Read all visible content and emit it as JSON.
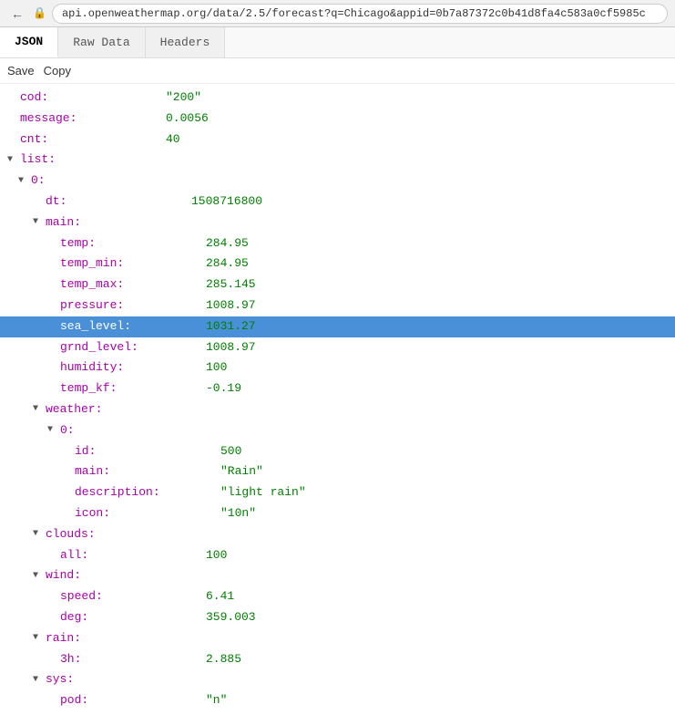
{
  "browser": {
    "url": "api.openweathermap.org/data/2.5/forecast?q=Chicago&appid=0b7a87372c0b41d8fa4c583a0cf5985c",
    "back_label": "←",
    "reload_label": "↻"
  },
  "tabs": [
    {
      "id": "json",
      "label": "JSON",
      "active": true
    },
    {
      "id": "raw",
      "label": "Raw Data",
      "active": false
    },
    {
      "id": "headers",
      "label": "Headers",
      "active": false
    }
  ],
  "toolbar": {
    "save_label": "Save",
    "copy_label": "Copy"
  },
  "json": {
    "rows": [
      {
        "indent": 0,
        "key": "cod:",
        "value": "\"200\"",
        "type": "string",
        "toggle": null
      },
      {
        "indent": 0,
        "key": "message:",
        "value": "0.0056",
        "type": "number",
        "toggle": null
      },
      {
        "indent": 0,
        "key": "cnt:",
        "value": "40",
        "type": "number",
        "toggle": null
      },
      {
        "indent": 0,
        "key": "list:",
        "value": "",
        "type": "section",
        "toggle": "▼"
      },
      {
        "indent": 1,
        "key": "0:",
        "value": "",
        "type": "section",
        "toggle": "▼"
      },
      {
        "indent": 2,
        "key": "dt:",
        "value": "1508716800",
        "type": "number",
        "toggle": null
      },
      {
        "indent": 2,
        "key": "main:",
        "value": "",
        "type": "section",
        "toggle": "▼"
      },
      {
        "indent": 3,
        "key": "temp:",
        "value": "284.95",
        "type": "number",
        "toggle": null
      },
      {
        "indent": 3,
        "key": "temp_min:",
        "value": "284.95",
        "type": "number",
        "toggle": null
      },
      {
        "indent": 3,
        "key": "temp_max:",
        "value": "285.145",
        "type": "number",
        "toggle": null
      },
      {
        "indent": 3,
        "key": "pressure:",
        "value": "1008.97",
        "type": "number",
        "toggle": null
      },
      {
        "indent": 3,
        "key": "sea_level:",
        "value": "1031.27",
        "type": "number",
        "toggle": null,
        "highlighted": true
      },
      {
        "indent": 3,
        "key": "grnd_level:",
        "value": "1008.97",
        "type": "number",
        "toggle": null
      },
      {
        "indent": 3,
        "key": "humidity:",
        "value": "100",
        "type": "number",
        "toggle": null
      },
      {
        "indent": 3,
        "key": "temp_kf:",
        "value": "-0.19",
        "type": "number",
        "toggle": null
      },
      {
        "indent": 2,
        "key": "weather:",
        "value": "",
        "type": "section",
        "toggle": "▼"
      },
      {
        "indent": 3,
        "key": "0:",
        "value": "",
        "type": "section",
        "toggle": "▼"
      },
      {
        "indent": 4,
        "key": "id:",
        "value": "500",
        "type": "number",
        "toggle": null
      },
      {
        "indent": 4,
        "key": "main:",
        "value": "\"Rain\"",
        "type": "string",
        "toggle": null
      },
      {
        "indent": 4,
        "key": "description:",
        "value": "\"light rain\"",
        "type": "string",
        "toggle": null
      },
      {
        "indent": 4,
        "key": "icon:",
        "value": "\"10n\"",
        "type": "string",
        "toggle": null
      },
      {
        "indent": 2,
        "key": "clouds:",
        "value": "",
        "type": "section",
        "toggle": "▼"
      },
      {
        "indent": 3,
        "key": "all:",
        "value": "100",
        "type": "number",
        "toggle": null
      },
      {
        "indent": 2,
        "key": "wind:",
        "value": "",
        "type": "section",
        "toggle": "▼"
      },
      {
        "indent": 3,
        "key": "speed:",
        "value": "6.41",
        "type": "number",
        "toggle": null
      },
      {
        "indent": 3,
        "key": "deg:",
        "value": "359.003",
        "type": "number",
        "toggle": null
      },
      {
        "indent": 2,
        "key": "rain:",
        "value": "",
        "type": "section",
        "toggle": "▼"
      },
      {
        "indent": 3,
        "key": "3h:",
        "value": "2.885",
        "type": "number",
        "toggle": null
      },
      {
        "indent": 2,
        "key": "sys:",
        "value": "",
        "type": "section",
        "toggle": "▼"
      },
      {
        "indent": 3,
        "key": "pod:",
        "value": "\"n\"",
        "type": "string",
        "toggle": null
      }
    ]
  }
}
